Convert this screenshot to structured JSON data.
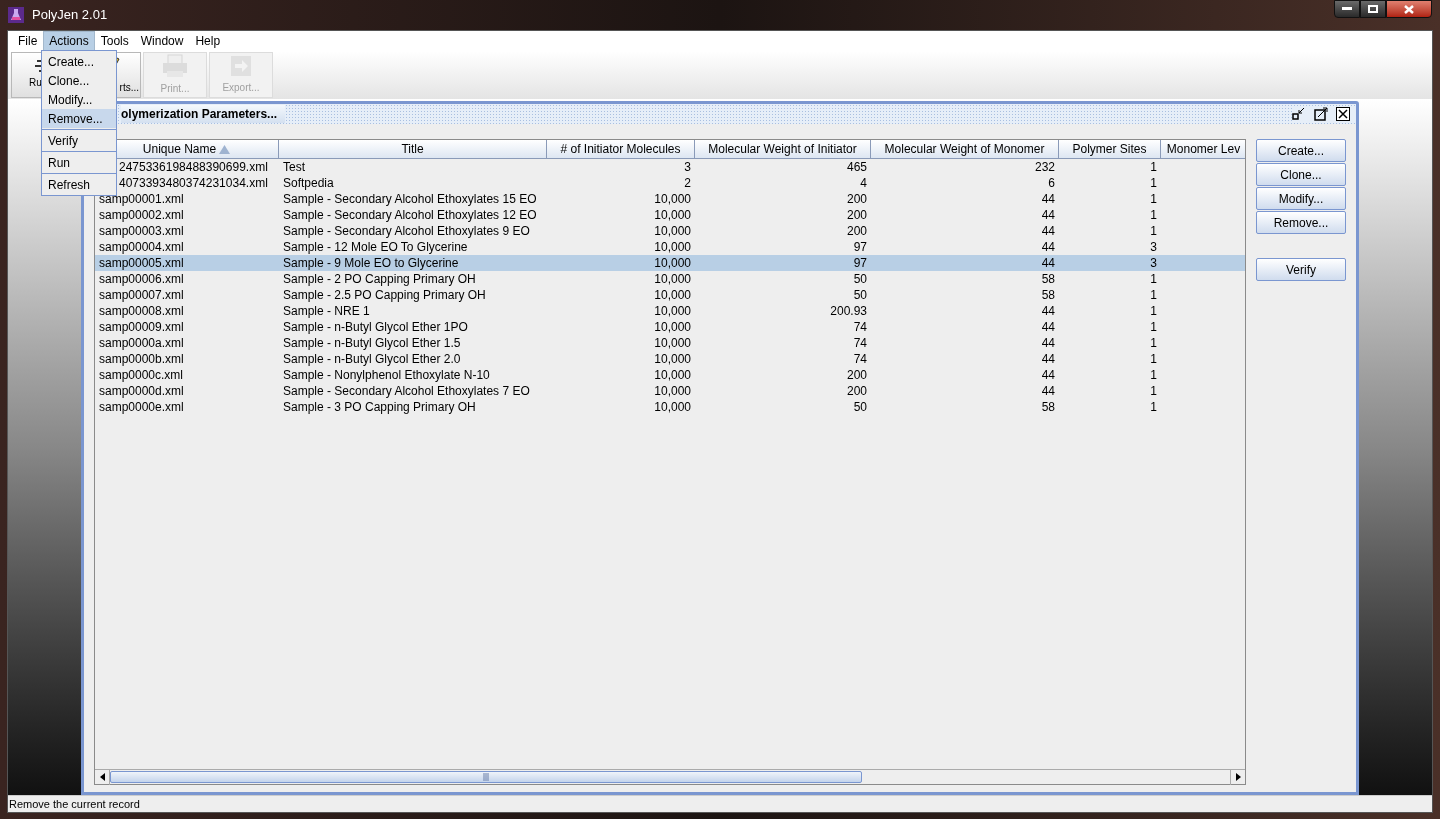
{
  "window": {
    "title": "PolyJen 2.01"
  },
  "menu_bar": [
    {
      "label": "File",
      "selected": false
    },
    {
      "label": "Actions",
      "selected": true
    },
    {
      "label": "Tools",
      "selected": false
    },
    {
      "label": "Window",
      "selected": false
    },
    {
      "label": "Help",
      "selected": false
    }
  ],
  "toolbar": [
    {
      "kind": "run",
      "label": "Ru",
      "disabled": false
    },
    {
      "kind": "reports",
      "label": "rts...",
      "disabled": false
    },
    {
      "kind": "print",
      "label": "Print...",
      "disabled": true
    },
    {
      "kind": "export",
      "label": "Export...",
      "disabled": true
    }
  ],
  "actions_menu": [
    {
      "kind": "item",
      "label": "Create...",
      "selected": false
    },
    {
      "kind": "item",
      "label": "Clone...",
      "selected": false
    },
    {
      "kind": "item",
      "label": "Modify...",
      "selected": false
    },
    {
      "kind": "item",
      "label": "Remove...",
      "selected": true
    },
    {
      "kind": "separator"
    },
    {
      "kind": "item",
      "label": "Verify",
      "selected": false
    },
    {
      "kind": "separator"
    },
    {
      "kind": "item",
      "label": "Run",
      "selected": false
    },
    {
      "kind": "separator"
    },
    {
      "kind": "item",
      "label": "Refresh",
      "selected": false
    }
  ],
  "internal_frame": {
    "title": "olymerization Parameters..."
  },
  "table": {
    "columns": [
      {
        "label": "Unique Name",
        "sorted": true
      },
      {
        "label": "Title",
        "sorted": false
      },
      {
        "label": "# of Initiator Molecules",
        "sorted": false
      },
      {
        "label": "Molecular Weight of Initiator",
        "sorted": false
      },
      {
        "label": "Molecular Weight of Monomer",
        "sorted": false
      },
      {
        "label": "Polymer Sites",
        "sorted": false
      },
      {
        "label": "Monomer Lev",
        "sorted": false
      }
    ],
    "rows": [
      {
        "selected": false,
        "cells": [
          "2475336198488390699.xml",
          "Test",
          "3",
          "465",
          "232",
          "1"
        ]
      },
      {
        "selected": false,
        "cells": [
          "4073393480374231034.xml",
          "Softpedia",
          "2",
          "4",
          "6",
          "1"
        ]
      },
      {
        "selected": false,
        "cells": [
          "samp00001.xml",
          "Sample - Secondary Alcohol Ethoxylates 15 EO",
          "10,000",
          "200",
          "44",
          "1"
        ]
      },
      {
        "selected": false,
        "cells": [
          "samp00002.xml",
          "Sample - Secondary Alcohol Ethoxylates 12 EO",
          "10,000",
          "200",
          "44",
          "1"
        ]
      },
      {
        "selected": false,
        "cells": [
          "samp00003.xml",
          "Sample - Secondary Alcohol Ethoxylates 9 EO",
          "10,000",
          "200",
          "44",
          "1"
        ]
      },
      {
        "selected": false,
        "cells": [
          "samp00004.xml",
          "Sample - 12 Mole EO To Glycerine",
          "10,000",
          "97",
          "44",
          "3"
        ]
      },
      {
        "selected": true,
        "cells": [
          "samp00005.xml",
          "Sample - 9 Mole EO to Glycerine",
          "10,000",
          "97",
          "44",
          "3"
        ]
      },
      {
        "selected": false,
        "cells": [
          "samp00006.xml",
          "Sample - 2 PO Capping Primary OH",
          "10,000",
          "50",
          "58",
          "1"
        ]
      },
      {
        "selected": false,
        "cells": [
          "samp00007.xml",
          "Sample - 2.5 PO Capping Primary OH",
          "10,000",
          "50",
          "58",
          "1"
        ]
      },
      {
        "selected": false,
        "cells": [
          "samp00008.xml",
          "Sample - NRE 1",
          "10,000",
          "200.93",
          "44",
          "1"
        ]
      },
      {
        "selected": false,
        "cells": [
          "samp00009.xml",
          "Sample - n-Butyl Glycol Ether 1PO",
          "10,000",
          "74",
          "44",
          "1"
        ]
      },
      {
        "selected": false,
        "cells": [
          "samp0000a.xml",
          "Sample - n-Butyl Glycol Ether 1.5",
          "10,000",
          "74",
          "44",
          "1"
        ]
      },
      {
        "selected": false,
        "cells": [
          "samp0000b.xml",
          "Sample - n-Butyl Glycol Ether 2.0",
          "10,000",
          "74",
          "44",
          "1"
        ]
      },
      {
        "selected": false,
        "cells": [
          "samp0000c.xml",
          "Sample - Nonylphenol Ethoxylate N-10",
          "10,000",
          "200",
          "44",
          "1"
        ]
      },
      {
        "selected": false,
        "cells": [
          "samp0000d.xml",
          "Sample - Secondary Alcohol Ethoxylates 7 EO",
          "10,000",
          "200",
          "44",
          "1"
        ]
      },
      {
        "selected": false,
        "cells": [
          "samp0000e.xml",
          "Sample - 3 PO Capping Primary OH",
          "10,000",
          "50",
          "58",
          "1"
        ]
      }
    ]
  },
  "side_buttons": [
    [
      "Create...",
      "Clone...",
      "Modify...",
      "Remove..."
    ],
    [
      "Verify"
    ]
  ],
  "status_bar": "Remove the current record"
}
